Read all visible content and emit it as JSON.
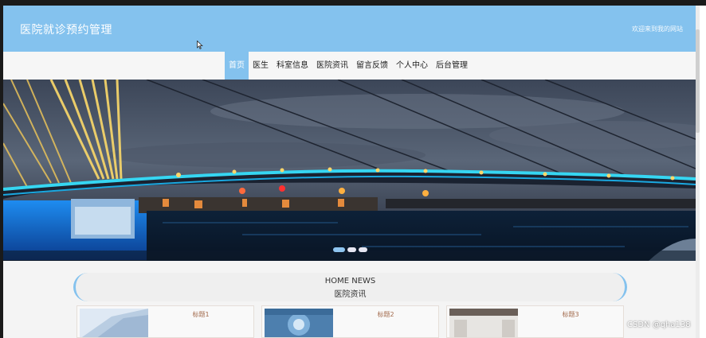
{
  "header": {
    "title": "医院就诊预约管理",
    "welcome": "欢迎来到我的网站"
  },
  "nav": {
    "items": [
      {
        "label": "首页",
        "active": true
      },
      {
        "label": "医生",
        "active": false
      },
      {
        "label": "科室信息",
        "active": false
      },
      {
        "label": "医院资讯",
        "active": false
      },
      {
        "label": "留言反馈",
        "active": false
      },
      {
        "label": "个人中心",
        "active": false
      },
      {
        "label": "后台管理",
        "active": false
      }
    ]
  },
  "carousel": {
    "slide_count": 3,
    "active_index": 0
  },
  "news": {
    "heading_en": "HOME NEWS",
    "heading_cn": "医院资讯",
    "cards": [
      {
        "title": "标题1"
      },
      {
        "title": "标题2"
      },
      {
        "title": "标题3"
      }
    ]
  },
  "watermark": "CSDN @qha138",
  "colors": {
    "accent": "#84c2ee",
    "card_title": "#a26a4c",
    "page_bg": "#f4f4f4"
  }
}
